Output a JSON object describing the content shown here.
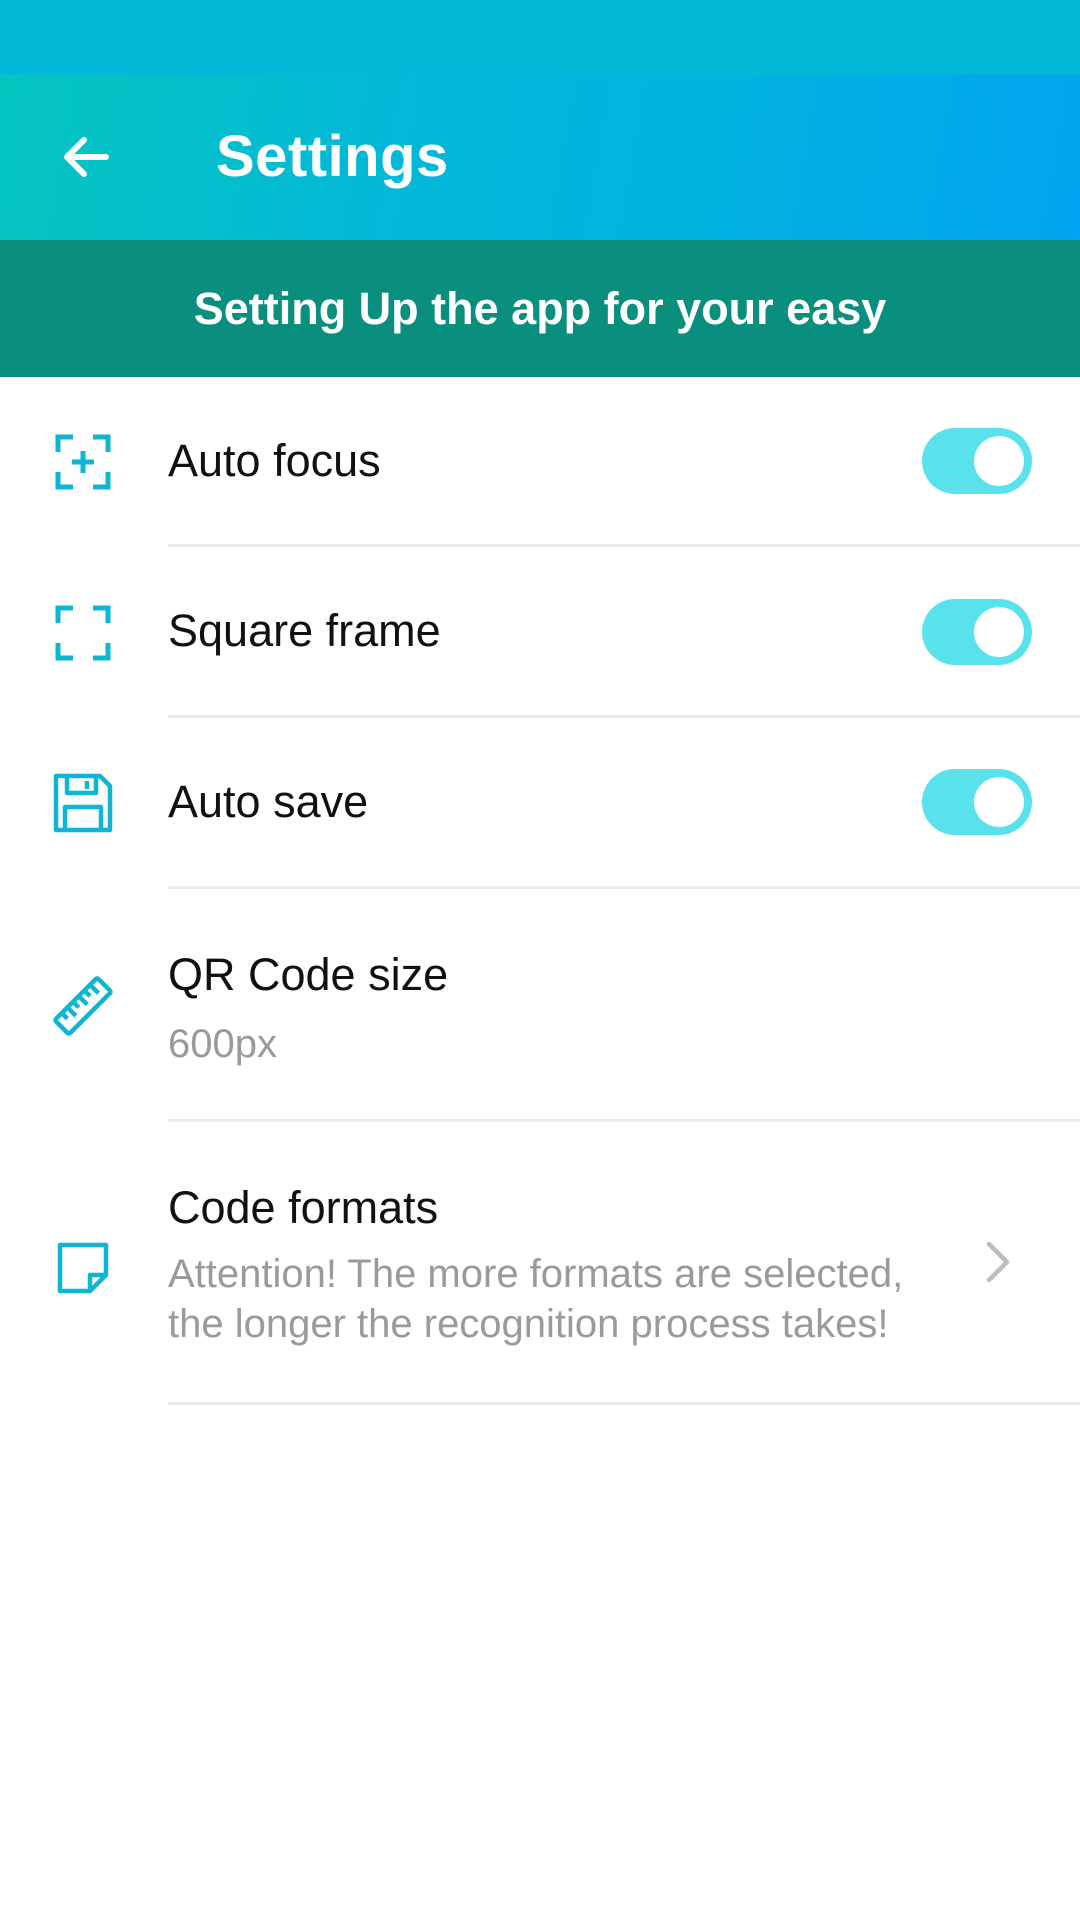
{
  "app_bar": {
    "title": "Settings",
    "back_icon": "arrow-left-icon"
  },
  "banner": {
    "text": "Setting Up the app for your easy"
  },
  "settings": [
    {
      "icon": "autofocus-icon",
      "title": "Auto focus",
      "type": "toggle",
      "enabled": true
    },
    {
      "icon": "square-frame-icon",
      "title": "Square frame",
      "type": "toggle",
      "enabled": true
    },
    {
      "icon": "floppy-disk-icon",
      "title": "Auto save",
      "type": "toggle",
      "enabled": true
    },
    {
      "icon": "ruler-icon",
      "title": "QR Code size",
      "subtitle": "600px",
      "type": "value"
    },
    {
      "icon": "note-icon",
      "title": "Code formats",
      "subtitle": "Attention! The more formats are selected, the longer the recognition process takes!",
      "type": "link"
    }
  ],
  "colors": {
    "accent": "#0fb6d4",
    "banner_bg": "#0a8f7f",
    "toggle_on": "#59e2ec",
    "status_bar": "#03b7d6"
  }
}
